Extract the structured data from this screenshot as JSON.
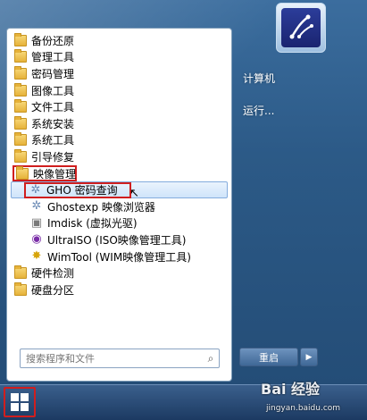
{
  "programs": [
    {
      "label": "备份还原",
      "kind": "folder"
    },
    {
      "label": "管理工具",
      "kind": "folder"
    },
    {
      "label": "密码管理",
      "kind": "folder"
    },
    {
      "label": "图像工具",
      "kind": "folder"
    },
    {
      "label": "文件工具",
      "kind": "folder"
    },
    {
      "label": "系统安装",
      "kind": "folder"
    },
    {
      "label": "系统工具",
      "kind": "folder"
    },
    {
      "label": "引导修复",
      "kind": "folder"
    },
    {
      "label": "映像管理",
      "kind": "folder",
      "highlight": true
    },
    {
      "label": "GHO 密码查询",
      "kind": "app",
      "icon": "star-icon",
      "selected": true
    },
    {
      "label": "Ghostexp 映像浏览器",
      "kind": "app",
      "icon": "star-icon"
    },
    {
      "label": "Imdisk (虚拟光驱)",
      "kind": "app",
      "icon": "disk-icon"
    },
    {
      "label": "UltraISO (ISO映像管理工具)",
      "kind": "app",
      "icon": "ultraiso-icon"
    },
    {
      "label": "WimTool (WIM映像管理工具)",
      "kind": "app",
      "icon": "wimtool-icon"
    },
    {
      "label": "硬件检测",
      "kind": "folder"
    },
    {
      "label": "硬盘分区",
      "kind": "folder"
    }
  ],
  "search": {
    "placeholder": "搜索程序和文件"
  },
  "right": {
    "computer": "计算机",
    "run": "运行..."
  },
  "shutdown": {
    "label": "重启",
    "arrow": "▶"
  },
  "watermark": {
    "brand": "Bai 经验",
    "url": "jingyan.baidu.com"
  },
  "colors": {
    "highlight_red": "#d01e1e",
    "selection_blue": "#cfe4fa"
  }
}
